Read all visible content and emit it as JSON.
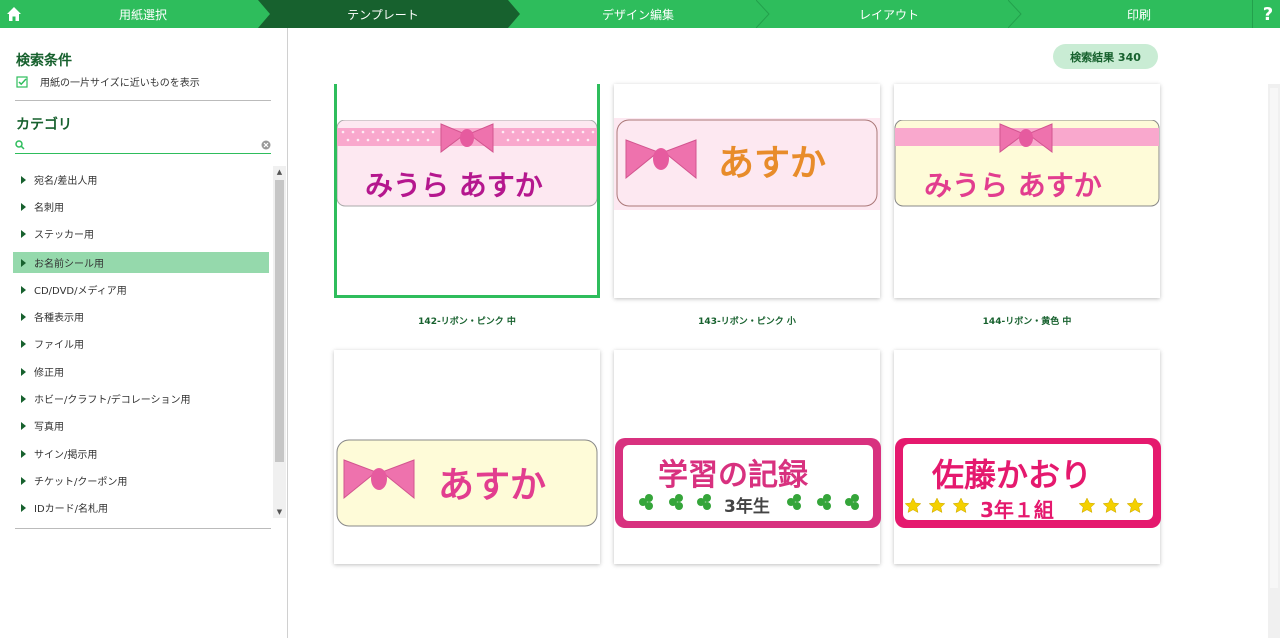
{
  "steps": [
    {
      "label": "用紙選択"
    },
    {
      "label": "テンプレート"
    },
    {
      "label": "デザイン編集"
    },
    {
      "label": "レイアウト"
    },
    {
      "label": "印刷"
    }
  ],
  "help_label": "?",
  "sidebar": {
    "search_conditions_title": "検索条件",
    "condition_label": "用紙の一片サイズに近いものを表示",
    "category_title": "カテゴリ",
    "search_placeholder": "",
    "categories": [
      {
        "label": "宛名/差出人用"
      },
      {
        "label": "名刺用"
      },
      {
        "label": "ステッカー用"
      },
      {
        "label": "お名前シール用"
      },
      {
        "label": "CD/DVD/メディア用"
      },
      {
        "label": "各種表示用"
      },
      {
        "label": "ファイル用"
      },
      {
        "label": "修正用"
      },
      {
        "label": "ホビー/クラフト/デコレーション用"
      },
      {
        "label": "写真用"
      },
      {
        "label": "サイン/掲示用"
      },
      {
        "label": "チケット/クーポン用"
      },
      {
        "label": "IDカード/名札用"
      }
    ],
    "selected_category": "お名前シール用"
  },
  "main": {
    "result_badge": "検索結果 340",
    "templates": [
      {
        "caption": "142-リボン・ピンク 中",
        "text": "みうら あすか"
      },
      {
        "caption": "143-リボン・ピンク 小",
        "text": "あすか"
      },
      {
        "caption": "144-リボン・黄色 中",
        "text": "みうら あすか"
      },
      {
        "caption": "",
        "text": "あすか"
      },
      {
        "caption": "",
        "title": "学習の記録",
        "sub": "3年生"
      },
      {
        "caption": "",
        "title": "佐藤かおり",
        "sub": "3年１組"
      }
    ]
  },
  "colors": {
    "accent": "#2ebd5c",
    "dark_green": "#17612e",
    "selected_bg": "#95d9ac",
    "pink": "#e23d8f",
    "magenta": "#b5178e"
  }
}
